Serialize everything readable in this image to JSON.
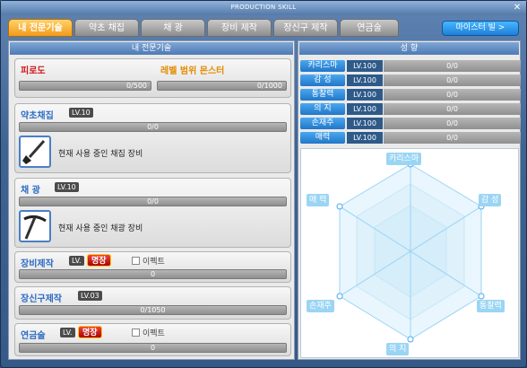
{
  "window": {
    "title": "PRODUCTION SKILL",
    "close_glyph": "✕"
  },
  "tabs": [
    {
      "label": "내 전문기술",
      "active": true
    },
    {
      "label": "약초 채집",
      "active": false
    },
    {
      "label": "채 광",
      "active": false
    },
    {
      "label": "장비 제작",
      "active": false
    },
    {
      "label": "장신구 제작",
      "active": false
    },
    {
      "label": "연금술",
      "active": false
    }
  ],
  "mastery_button": {
    "label": "마이스터 빌 >"
  },
  "left_header": "내 전문기술",
  "right_header": "성 향",
  "fatigue": {
    "label": "피로도",
    "value": "0/500"
  },
  "level_range": {
    "label": "레벨 범위 몬스터",
    "value": "0/1000"
  },
  "skills": [
    {
      "name": "약초채집",
      "level": "LV.10",
      "progress": "0/0",
      "tool_text": "현재 사용 중인 채집 장비",
      "icon": "shovel-icon"
    },
    {
      "name": "채 광",
      "level": "LV.10",
      "progress": "0/0",
      "tool_text": "현재 사용 중인 채광 장비",
      "icon": "pickaxe-icon"
    },
    {
      "name": "장비제작",
      "level": "LV.",
      "badge": "명장",
      "effect_label": "이펙트",
      "progress": "0"
    },
    {
      "name": "장신구제작",
      "level": "LV.03",
      "progress": "0/1050"
    },
    {
      "name": "연금술",
      "level": "LV.",
      "badge": "명장",
      "effect_label": "이펙트",
      "progress": "0"
    }
  ],
  "traits": [
    {
      "name": "카리스마",
      "level": "LV.100",
      "value": "0/0"
    },
    {
      "name": "감 성",
      "level": "LV.100",
      "value": "0/0"
    },
    {
      "name": "통찰력",
      "level": "LV.100",
      "value": "0/0"
    },
    {
      "name": "의 지",
      "level": "LV.100",
      "value": "0/0"
    },
    {
      "name": "손재주",
      "level": "LV.100",
      "value": "0/0"
    },
    {
      "name": "매력",
      "level": "LV.100",
      "value": "0/0"
    }
  ],
  "radar_labels": [
    "카리스마",
    "감 성",
    "통찰력",
    "의 지",
    "손재주",
    "매 력"
  ],
  "colors": {
    "accent": "#f39a1c",
    "skill_label": "#2b6cc4",
    "warning": "#d01818"
  }
}
